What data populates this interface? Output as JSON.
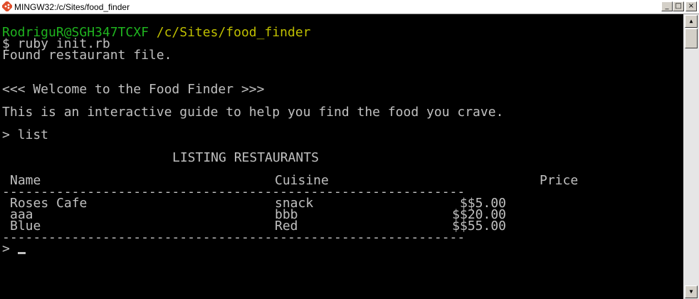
{
  "window": {
    "title": "MINGW32:/c/Sites/food_finder",
    "icon": "git-icon",
    "minimize_glyph": "_",
    "maximize_glyph": "□",
    "close_glyph": "×"
  },
  "colors": {
    "background": "#000000",
    "text": "#c0c0c0",
    "prompt_user": "#1fb31f",
    "prompt_path": "#bfbf00"
  },
  "terminal": {
    "prompt_user": "RodriguR@SGH347TCXF",
    "prompt_path": "/c/Sites/food_finder",
    "command": "$ ruby init.rb",
    "found_message": "Found restaurant file.",
    "welcome": "<<< Welcome to the Food Finder >>>",
    "intro": "This is an interactive guide to help you find the food you crave.",
    "list_command": "> list",
    "listing_title": "LISTING RESTAURANTS",
    "columns": {
      "name": "Name",
      "cuisine": "Cuisine",
      "price": "Price"
    },
    "separator": "------------------------------------------------------------",
    "restaurants": [
      {
        "name": "Roses Cafe",
        "cuisine": "snack",
        "price": "$$5.00"
      },
      {
        "name": "aaa",
        "cuisine": "bbb",
        "price": "$$20.00"
      },
      {
        "name": "Blue",
        "cuisine": "Red",
        "price": "$$55.00"
      }
    ],
    "input_prompt": "> "
  },
  "scrollbar": {
    "up_glyph": "▲",
    "down_glyph": "▼"
  }
}
